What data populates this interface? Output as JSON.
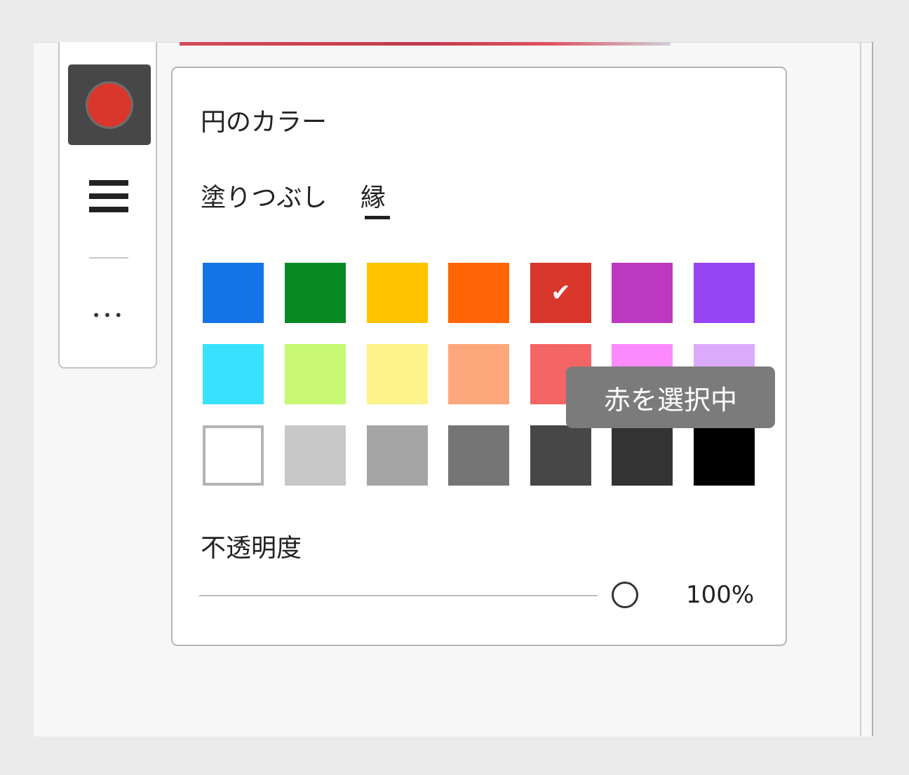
{
  "toolbar": {
    "color_button": {
      "icon": "filled-circle-icon",
      "color": "#d9372b"
    },
    "stroke_icon": "stroke-weight-icon",
    "more_label": "•••"
  },
  "panel": {
    "title": "円のカラー",
    "tabs": [
      {
        "label": "塗りつぶし",
        "active": false
      },
      {
        "label": "縁",
        "active": true
      }
    ],
    "swatches": [
      {
        "name": "blue",
        "color": "#1473e6"
      },
      {
        "name": "green",
        "color": "#0a8a24"
      },
      {
        "name": "yellow",
        "color": "#ffc300"
      },
      {
        "name": "orange",
        "color": "#ff6505"
      },
      {
        "name": "red",
        "color": "#d9372b",
        "selected": true
      },
      {
        "name": "magenta",
        "color": "#bd38c0"
      },
      {
        "name": "purple",
        "color": "#9745f5"
      },
      {
        "name": "light-blue",
        "color": "#38e2fe"
      },
      {
        "name": "light-green",
        "color": "#c8f874"
      },
      {
        "name": "light-yellow",
        "color": "#fdf38a"
      },
      {
        "name": "light-orange",
        "color": "#fda87c"
      },
      {
        "name": "light-red",
        "color": "#f46566"
      },
      {
        "name": "light-pink",
        "color": "#fc8afc"
      },
      {
        "name": "light-purple",
        "color": "#dcaafa"
      },
      {
        "name": "white",
        "color": "#ffffff"
      },
      {
        "name": "light-gray",
        "color": "#c8c8c8"
      },
      {
        "name": "gray",
        "color": "#a5a5a5"
      },
      {
        "name": "mid-gray",
        "color": "#757575"
      },
      {
        "name": "dark-gray",
        "color": "#474747"
      },
      {
        "name": "darker-gray",
        "color": "#333333"
      },
      {
        "name": "black",
        "color": "#000000"
      }
    ],
    "opacity_label": "不透明度",
    "opacity_value": "100%",
    "opacity": 1.0
  },
  "tooltip": "赤を選択中"
}
